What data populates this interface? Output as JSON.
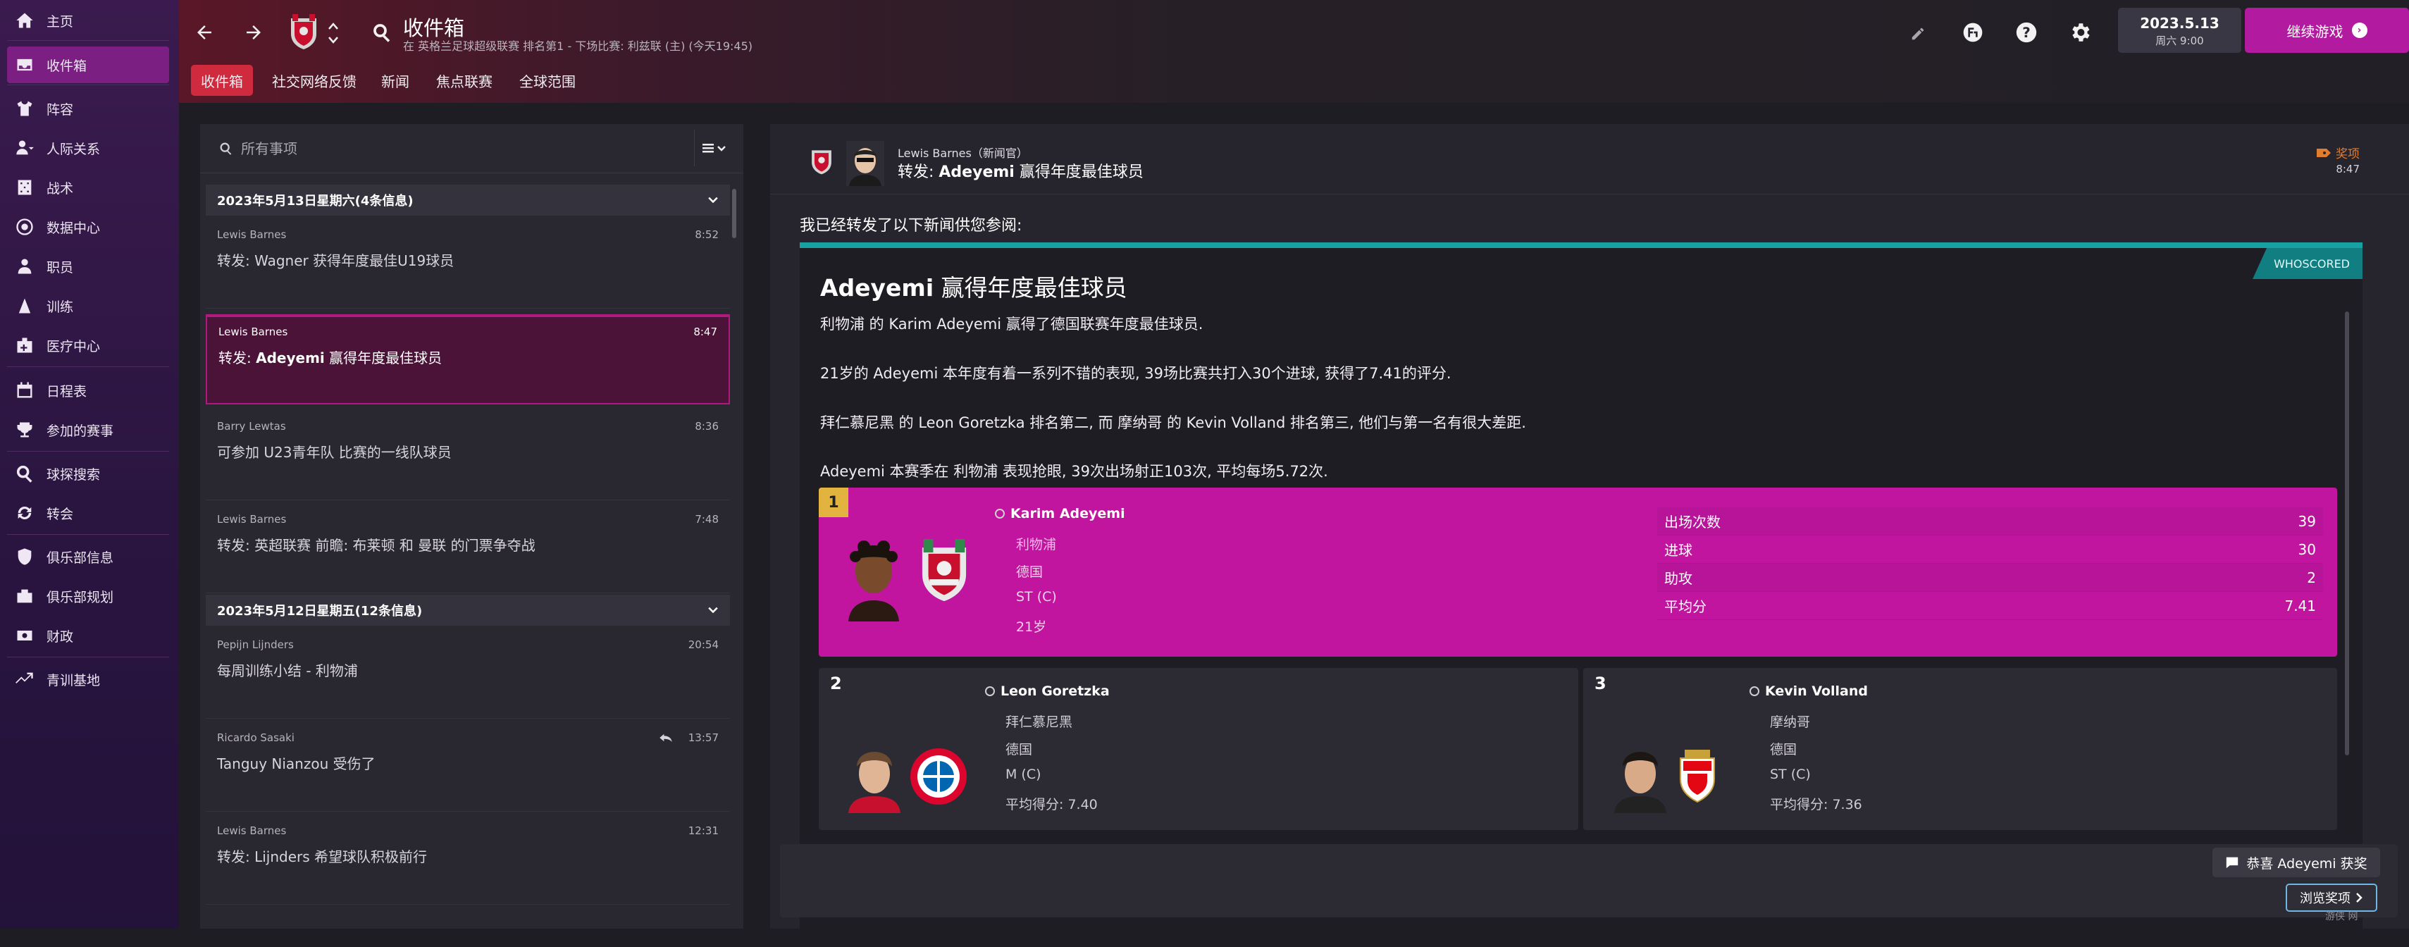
{
  "sidebar": {
    "items": [
      {
        "label": "主页",
        "icon": "home-icon"
      },
      {
        "label": "收件箱",
        "icon": "inbox-icon",
        "active": true
      },
      {
        "label": "阵容",
        "icon": "squad-shirt-icon"
      },
      {
        "label": "人际关系",
        "icon": "relationships-icon"
      },
      {
        "label": "战术",
        "icon": "tactics-icon"
      },
      {
        "label": "数据中心",
        "icon": "data-hub-icon"
      },
      {
        "label": "职员",
        "icon": "staff-icon"
      },
      {
        "label": "训练",
        "icon": "training-icon"
      },
      {
        "label": "医疗中心",
        "icon": "medical-icon"
      },
      {
        "label": "日程表",
        "icon": "calendar-icon"
      },
      {
        "label": "参加的赛事",
        "icon": "trophy-icon"
      },
      {
        "label": "球探搜索",
        "icon": "scouting-icon"
      },
      {
        "label": "转会",
        "icon": "transfers-icon"
      },
      {
        "label": "俱乐部信息",
        "icon": "club-info-icon"
      },
      {
        "label": "俱乐部规划",
        "icon": "club-vision-icon"
      },
      {
        "label": "财政",
        "icon": "finances-icon"
      },
      {
        "label": "青训基地",
        "icon": "youth-icon"
      }
    ]
  },
  "header": {
    "title": "收件箱",
    "subtitle": "在 英格兰足球超级联赛 排名第1 - 下场比赛: 利兹联 (主) (今天19:45)",
    "tabs": [
      "收件箱",
      "社交网络反馈",
      "新闻",
      "焦点联赛",
      "全球范围"
    ],
    "date": "2023.5.13",
    "date_sub": "周六 9:00",
    "continue_label": "继续游戏"
  },
  "inbox": {
    "search_placeholder": "所有事项",
    "groups": [
      {
        "title": "2023年5月13日星期六(4条信息)",
        "messages": [
          {
            "sender": "Lewis Barnes",
            "time": "8:52",
            "subject": "转发: Wagner 获得年度最佳U19球员"
          },
          {
            "sender": "Lewis Barnes",
            "time": "8:47",
            "subject_prefix": "转发: ",
            "subject_bold": "Adeyemi",
            "subject_rest": " 赢得年度最佳球员",
            "active": true
          },
          {
            "sender": "Barry Lewtas",
            "time": "8:36",
            "subject": "可参加 U23青年队 比赛的一线队球员"
          },
          {
            "sender": "Lewis Barnes",
            "time": "7:48",
            "subject": "转发: 英超联赛 前瞻: 布莱顿 和 曼联 的门票争夺战"
          }
        ]
      },
      {
        "title": "2023年5月12日星期五(12条信息)",
        "messages": [
          {
            "sender": "Pepijn Lijnders",
            "time": "20:54",
            "subject": "每周训练小结 - 利物浦"
          },
          {
            "sender": "Ricardo Sasaki",
            "time": "13:57",
            "subject": "Tanguy Nianzou 受伤了",
            "replied": true
          },
          {
            "sender": "Lewis Barnes",
            "time": "12:31",
            "subject": "转发: Lijnders 希望球队积极前行"
          }
        ]
      }
    ]
  },
  "detail": {
    "from": "Lewis Barnes（新闻官）",
    "subject_prefix": "转发: ",
    "subject_bold": "Adeyemi",
    "subject_rest": " 赢得年度最佳球员",
    "tag": "奖项",
    "time": "8:47",
    "intro": "我已经转发了以下新闻供您参阅:",
    "article": {
      "source": "WHOSCORED",
      "title_bold": "Adeyemi",
      "title_rest": " 赢得年度最佳球员",
      "paragraphs": [
        "利物浦 的 Karim Adeyemi 赢得了德国联赛年度最佳球员.",
        "21岁的 Adeyemi 本年度有着一系列不错的表现, 39场比赛共打入30个进球, 获得了7.41的评分.",
        "拜仁慕尼黑 的 Leon Goretzka 排名第二, 而 摩纳哥 的 Kevin Volland 排名第三, 他们与第一名有很大差距.",
        "Adeyemi 本赛季在 利物浦 表现抢眼, 39次出场射正103次, 平均每场5.72次."
      ]
    },
    "players": [
      {
        "rank": "1",
        "name": "Karim Adeyemi",
        "club": "利物浦",
        "nation": "德国",
        "position": "ST (C)",
        "age": "21岁",
        "stats": [
          {
            "label": "出场次数",
            "value": "39"
          },
          {
            "label": "进球",
            "value": "30"
          },
          {
            "label": "助攻",
            "value": "2"
          },
          {
            "label": "平均分",
            "value": "7.41"
          }
        ]
      },
      {
        "rank": "2",
        "name": "Leon Goretzka",
        "club": "拜仁慕尼黑",
        "nation": "德国",
        "position": "M (C)",
        "rating": "平均得分: 7.40"
      },
      {
        "rank": "3",
        "name": "Kevin Volland",
        "club": "摩纳哥",
        "nation": "德国",
        "position": "ST (C)",
        "rating": "平均得分: 7.36"
      }
    ]
  },
  "actions": {
    "congrats_label": "恭喜 Adeyemi 获奖",
    "browse_label": "浏览奖项"
  },
  "watermark": "游侠 网",
  "colors": {
    "accent": "#c2159f",
    "tab_active": "#cf2a3d",
    "source_teal": "#17a1a3",
    "rank_gold": "#e2b43f"
  }
}
